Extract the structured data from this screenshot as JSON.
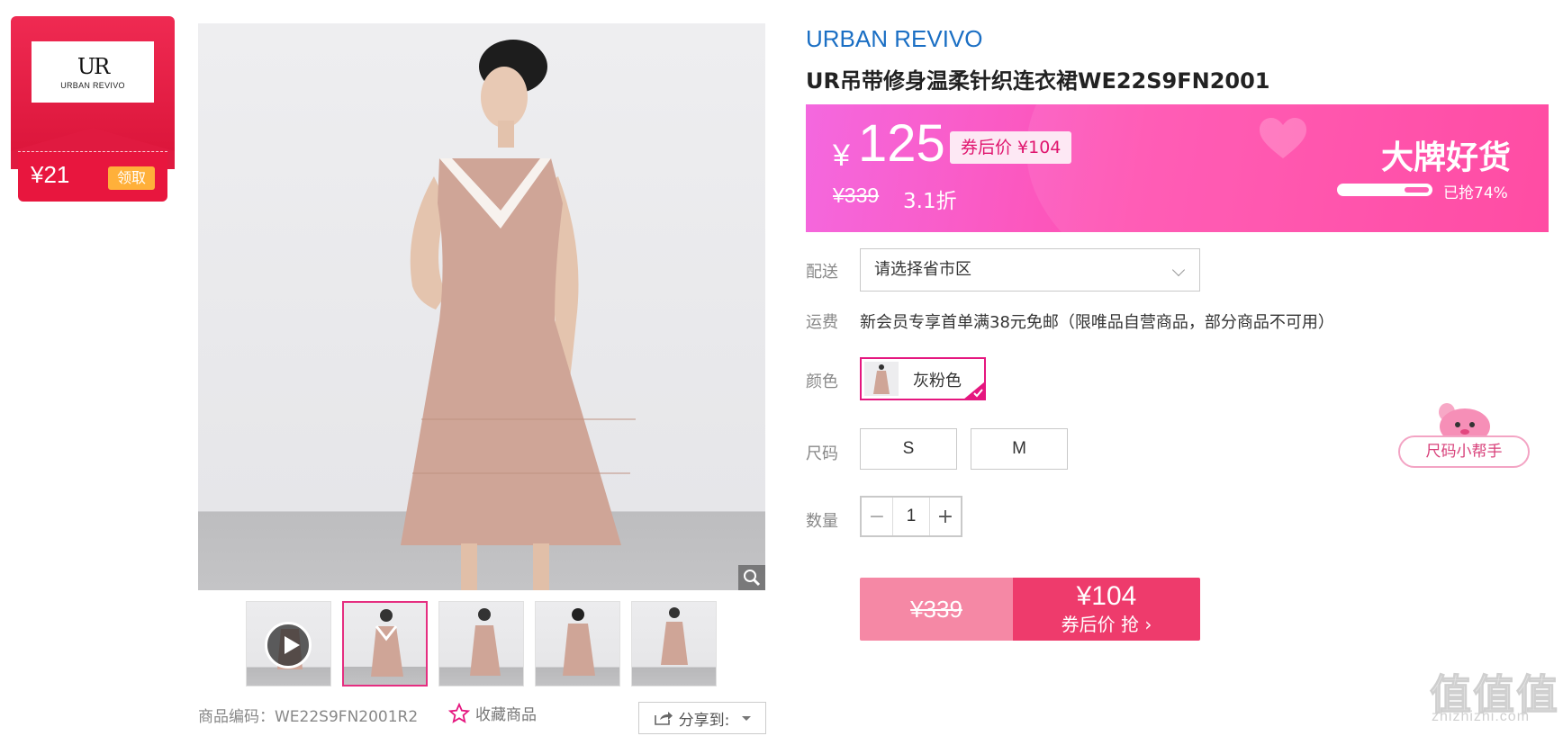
{
  "coupon": {
    "logo_mark": "UR",
    "logo_text": "URBAN REVIVO",
    "amount": "¥21",
    "get_label": "领取"
  },
  "gallery": {
    "thumbnails": [
      "video",
      "front",
      "side",
      "back",
      "full"
    ],
    "active_index": 1
  },
  "product": {
    "brand": "URBAN REVIVO",
    "title": "UR吊带修身温柔针织连衣裙WE22S9FN2001",
    "code_label": "商品编码：",
    "code": "WE22S9FN2001R2",
    "favorite_label": "收藏商品",
    "share_label": "分享到:"
  },
  "price": {
    "yen": "¥",
    "current": "125",
    "coupon_price_tag": "券后价 ¥104",
    "original": "¥339",
    "discount": "3.1折",
    "banner_tag": "大牌好货",
    "sold_progress": 0.74,
    "sold_text": "已抢74%"
  },
  "delivery": {
    "label": "配送",
    "placeholder": "请选择省市区"
  },
  "shipping": {
    "label": "运费",
    "text": "新会员专享首单满38元免邮（限唯品自营商品，部分商品不可用）"
  },
  "color": {
    "label": "颜色",
    "options": [
      {
        "name": "灰粉色",
        "selected": true
      }
    ]
  },
  "size": {
    "label": "尺码",
    "options": [
      "S",
      "M"
    ],
    "helper_label": "尺码小帮手"
  },
  "quantity": {
    "label": "数量",
    "value": "1",
    "minus": "−",
    "plus": "+"
  },
  "buy": {
    "original": "¥339",
    "coupon_price": "¥104",
    "action": "券后价 抢 ›"
  },
  "watermark": {
    "glyphs": "值值值",
    "url": "zhizhizhi.com"
  },
  "colors": {
    "brand_blue": "#1b6fc4",
    "banner_pink": "#ff50b0",
    "accent_red": "#e8163e",
    "buy_red": "#ee3b6c",
    "buy_pink": "#f588a5"
  }
}
